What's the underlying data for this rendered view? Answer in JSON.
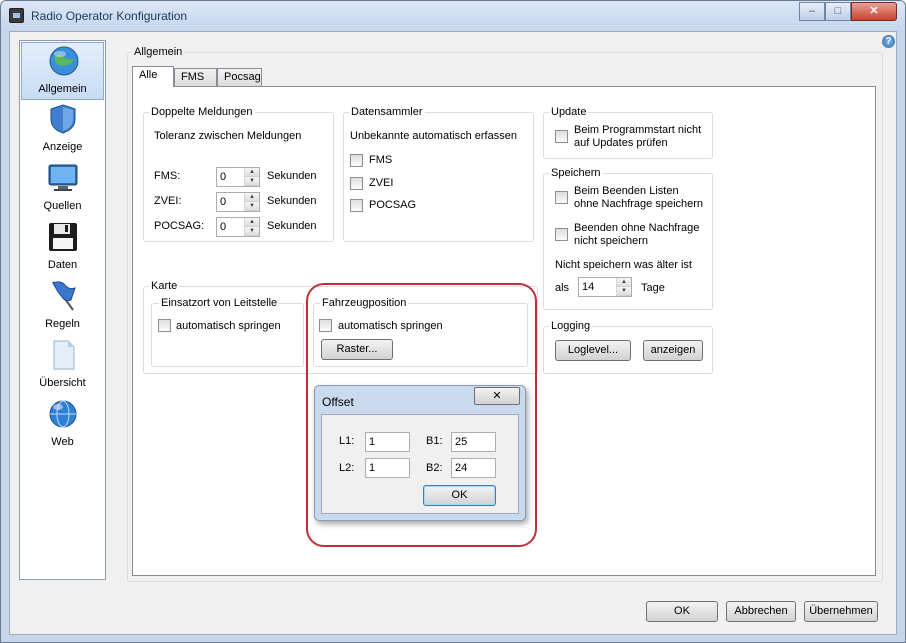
{
  "window": {
    "title": "Radio Operator Konfiguration",
    "controls": {
      "minimize": "–",
      "maximize": "□",
      "close": "✕"
    },
    "help": "?"
  },
  "sidebar": {
    "items": [
      {
        "label": "Allgemein",
        "icon": "globe-icon",
        "selected": true
      },
      {
        "label": "Anzeige",
        "icon": "shield-icon"
      },
      {
        "label": "Quellen",
        "icon": "monitor-icon"
      },
      {
        "label": "Daten",
        "icon": "floppy-disk-icon"
      },
      {
        "label": "Regeln",
        "icon": "flag-icon"
      },
      {
        "label": "Übersicht",
        "icon": "document-icon"
      },
      {
        "label": "Web",
        "icon": "web-globe-icon"
      }
    ]
  },
  "main": {
    "group_title": "Allgemein",
    "tabs": [
      {
        "label": "Alle"
      },
      {
        "label": "FMS"
      },
      {
        "label": "Pocsag"
      }
    ],
    "doppelte": {
      "title": "Doppelte Meldungen",
      "subtitle": "Toleranz zwischen Meldungen",
      "rows": [
        {
          "label": "FMS:",
          "value": "0",
          "unit": "Sekunden"
        },
        {
          "label": "ZVEI:",
          "value": "0",
          "unit": "Sekunden"
        },
        {
          "label": "POCSAG:",
          "value": "0",
          "unit": "Sekunden"
        }
      ]
    },
    "datensammler": {
      "title": "Datensammler",
      "subtitle": "Unbekannte automatisch erfassen",
      "options": [
        {
          "label": "FMS"
        },
        {
          "label": "ZVEI"
        },
        {
          "label": "POCSAG"
        }
      ]
    },
    "update": {
      "title": "Update",
      "line1": "Beim Programmstart nicht",
      "line2": "auf Updates prüfen"
    },
    "speichern": {
      "title": "Speichern",
      "opt1_line1": "Beim Beenden Listen",
      "opt1_line2": "ohne Nachfrage speichern",
      "opt2_line1": "Beenden ohne Nachfrage",
      "opt2_line2": "nicht speichern",
      "older_label": "Nicht speichern was älter ist",
      "als_label": "als",
      "days_value": "14",
      "days_unit": "Tage"
    },
    "karte": {
      "title": "Karte",
      "einsatzort": {
        "title": "Einsatzort von Leitstelle",
        "checkbox": "automatisch springen"
      },
      "fahrzeug": {
        "title": "Fahrzeugposition",
        "checkbox": "automatisch springen",
        "raster_button": "Raster..."
      }
    },
    "logging": {
      "title": "Logging",
      "loglevel_button": "Loglevel...",
      "anzeigen_button": "anzeigen"
    }
  },
  "offset_dialog": {
    "title": "Offset",
    "close": "✕",
    "fields": {
      "l1_label": "L1:",
      "l1_value": "1",
      "b1_label": "B1:",
      "b1_value": "25",
      "l2_label": "L2:",
      "l2_value": "1",
      "b2_label": "B2:",
      "b2_value": "24"
    },
    "ok": "OK"
  },
  "footer": {
    "ok": "OK",
    "cancel": "Abbrechen",
    "apply": "Übernehmen"
  }
}
